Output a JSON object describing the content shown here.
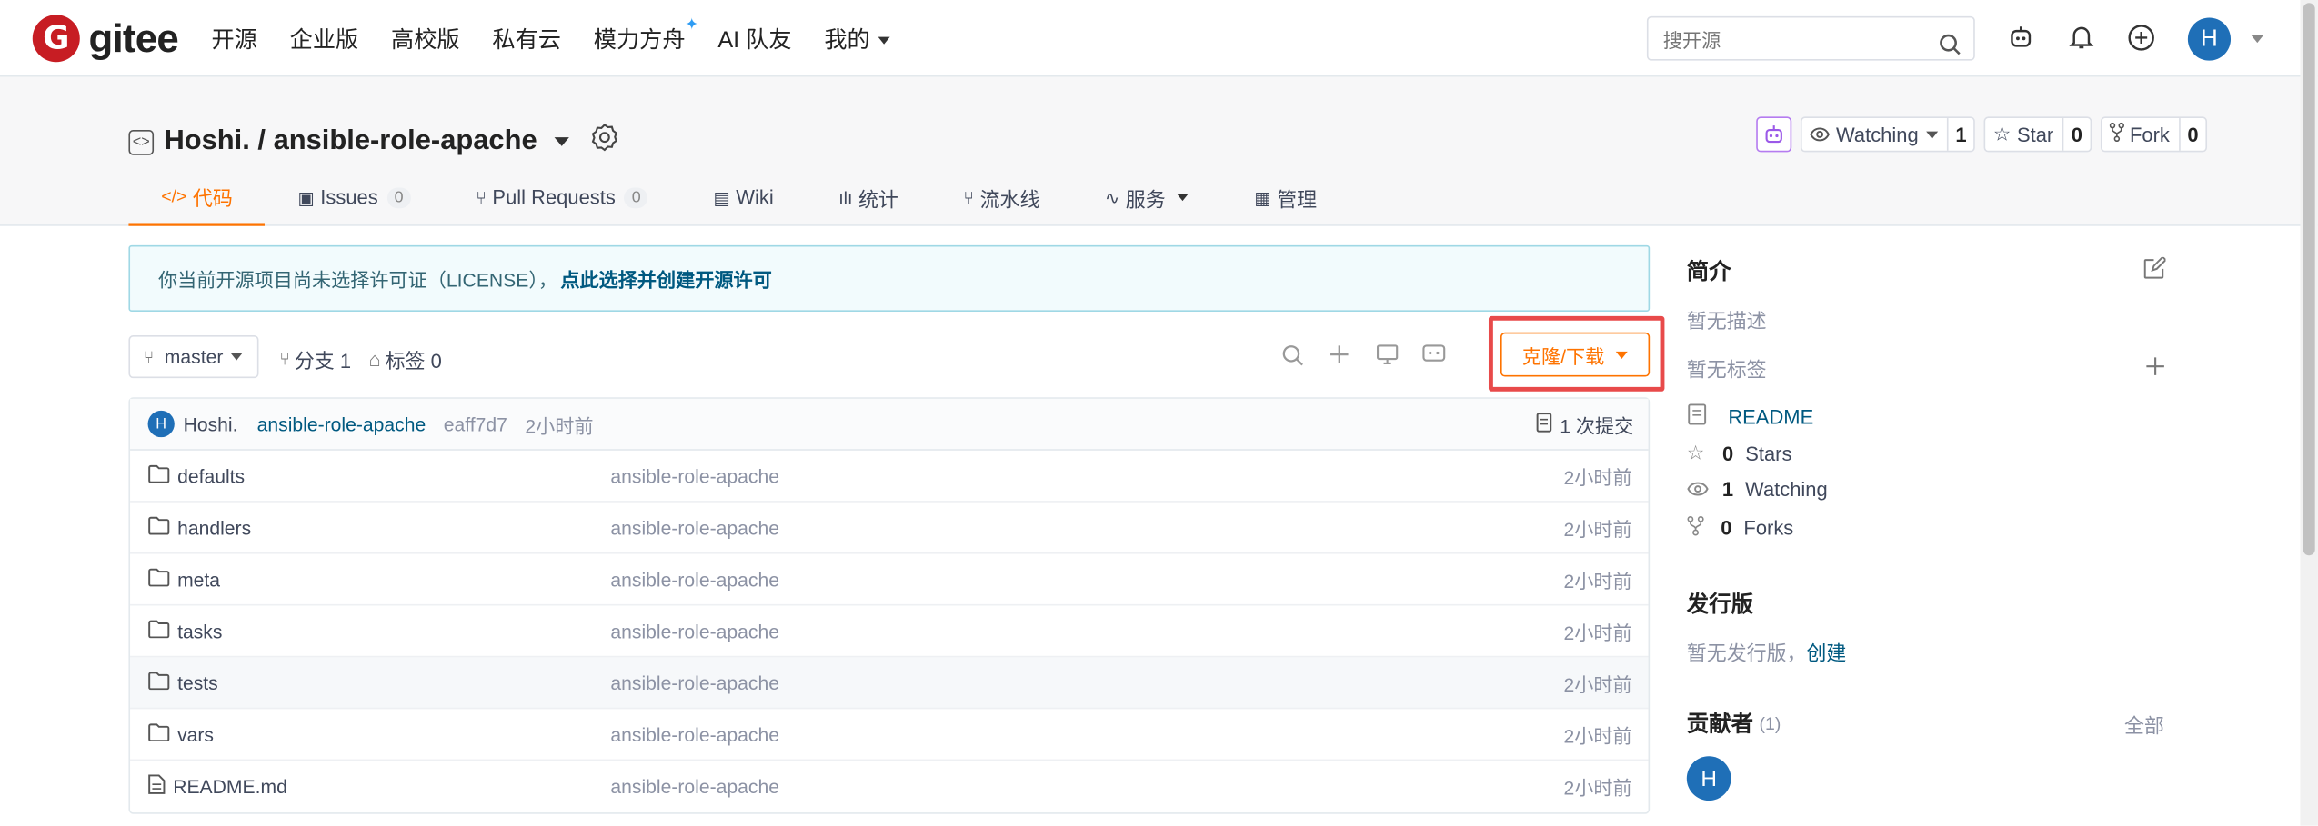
{
  "brand": {
    "name": "gitee",
    "logo_letter": "G",
    "color": "#c71d23"
  },
  "nav": {
    "links": [
      "开源",
      "企业版",
      "高校版",
      "私有云",
      "模力方舟",
      "AI 队友",
      "我的"
    ],
    "search_placeholder": "搜开源",
    "user_initial": "H"
  },
  "repo": {
    "title": "Hoshi. / ansible-role-apache",
    "watching_label": "Watching",
    "watching_count": "1",
    "star_label": "Star",
    "star_count": "0",
    "fork_label": "Fork",
    "fork_count": "0"
  },
  "tabs": [
    {
      "label": "代码",
      "active": true
    },
    {
      "label": "Issues",
      "count": "0"
    },
    {
      "label": "Pull Requests",
      "count": "0"
    },
    {
      "label": "Wiki"
    },
    {
      "label": "统计"
    },
    {
      "label": "流水线"
    },
    {
      "label": "服务"
    },
    {
      "label": "管理"
    }
  ],
  "license_notice": {
    "text": "你当前开源项目尚未选择许可证（LICENSE），",
    "link": "点此选择并创建开源许可"
  },
  "toolbar": {
    "branch": "master",
    "branches": "分支 1",
    "tags": "标签 0",
    "clone_label": "克隆/下载"
  },
  "commit": {
    "author": "Hoshi.",
    "avatar_initial": "H",
    "message": "ansible-role-apache",
    "sha": "eaff7d7",
    "time": "2小时前",
    "commits_label": "1 次提交"
  },
  "files": [
    {
      "name": "defaults",
      "type": "folder",
      "message": "ansible-role-apache",
      "time": "2小时前"
    },
    {
      "name": "handlers",
      "type": "folder",
      "message": "ansible-role-apache",
      "time": "2小时前"
    },
    {
      "name": "meta",
      "type": "folder",
      "message": "ansible-role-apache",
      "time": "2小时前"
    },
    {
      "name": "tasks",
      "type": "folder",
      "message": "ansible-role-apache",
      "time": "2小时前"
    },
    {
      "name": "tests",
      "type": "folder",
      "message": "ansible-role-apache",
      "time": "2小时前"
    },
    {
      "name": "vars",
      "type": "folder",
      "message": "ansible-role-apache",
      "time": "2小时前"
    },
    {
      "name": "README.md",
      "type": "file",
      "message": "ansible-role-apache",
      "time": "2小时前"
    }
  ],
  "sidebar": {
    "intro_title": "简介",
    "no_desc": "暂无描述",
    "no_tags": "暂无标签",
    "readme": "README",
    "stars_count": "0",
    "stars_label": "Stars",
    "watching_count": "1",
    "watching_label": "Watching",
    "forks_count": "0",
    "forks_label": "Forks",
    "release_title": "发行版",
    "no_release": "暂无发行版，",
    "create_link": "创建",
    "contributors_title": "贡献者",
    "contributors_count": "(1)",
    "all_link": "全部",
    "contributor_initial": "H"
  },
  "colors": {
    "accent": "#fe7300",
    "link": "#005980",
    "highlight_box": "#e84a4a"
  }
}
